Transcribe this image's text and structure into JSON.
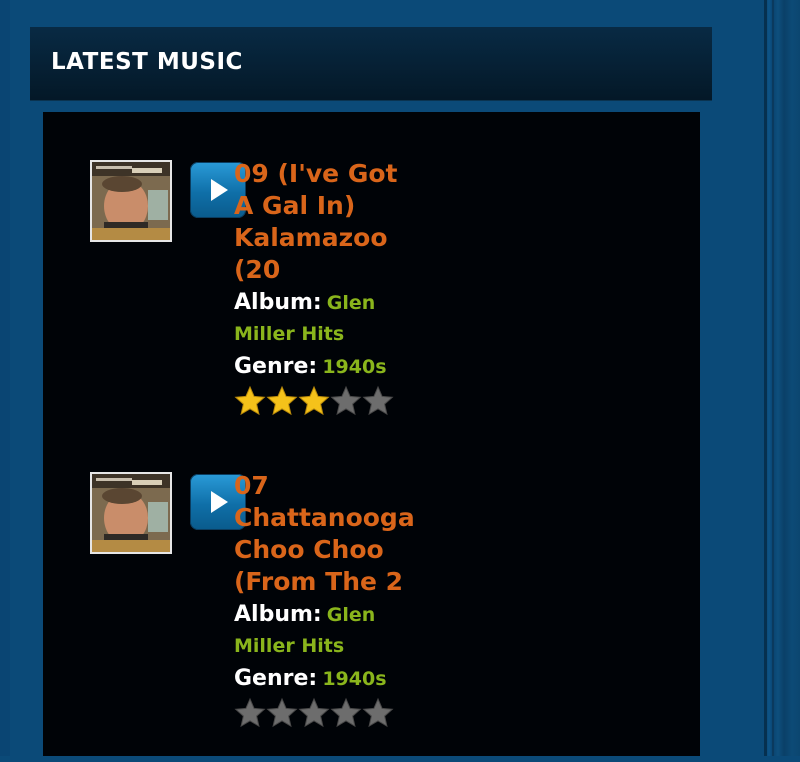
{
  "widget": {
    "title": "LATEST MUSIC"
  },
  "tracks": [
    {
      "title": "09 (I've Got A Gal In) Kalamazoo (20",
      "album_label": "Album:",
      "album": "Glen Miller Hits",
      "genre_label": "Genre:",
      "genre": "1940s",
      "rating": 3,
      "rating_max": 5
    },
    {
      "title": "07 Chattanooga Choo Choo (From The 2",
      "album_label": "Album:",
      "album": "Glen Miller Hits",
      "genre_label": "Genre:",
      "genre": "1940s",
      "rating": 0,
      "rating_max": 5
    }
  ],
  "colors": {
    "background": "#0b4a78",
    "panel": "#000307",
    "title_link": "#d9651a",
    "meta_value": "#8ab51c",
    "star_on": "#f5c21a",
    "star_off": "#6d6d6d"
  },
  "icons": {
    "play": "play-icon",
    "star_filled": "star-filled-icon",
    "star_empty": "star-empty-icon"
  }
}
